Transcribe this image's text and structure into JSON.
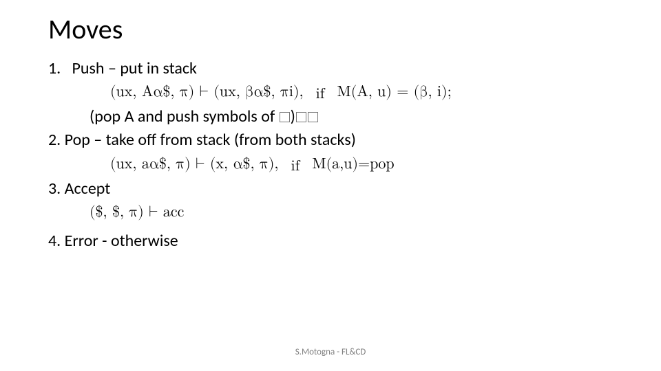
{
  "title": "Moves",
  "items": {
    "push": {
      "num": "1.",
      "label": "Push – put in stack",
      "formula": "(ux, Aα$, π) ⊢ (ux, βα$, πi),",
      "if": "if",
      "cond": "M(A, u) = (β, i);",
      "note_prefix": "(pop A and push symbols of ",
      "note_suffix": ")"
    },
    "pop": {
      "label": "2. Pop – take off from stack (from both stacks)",
      "formula": "(ux, aα$, π) ⊢ (x, α$, π),",
      "if": "if",
      "cond": "M(a,u)=pop"
    },
    "accept": {
      "label": "3. Accept",
      "formula": "($, $, π) ⊢ acc"
    },
    "error": {
      "label": "4. Error - otherwise"
    }
  },
  "footer": "S.Motogna - FL&CD"
}
